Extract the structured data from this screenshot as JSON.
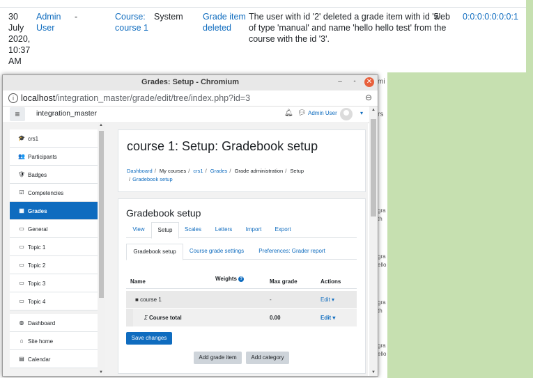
{
  "background_log": {
    "date": [
      "30",
      "July",
      "2020,",
      "10:37",
      "AM"
    ],
    "user": [
      "Admin",
      "User"
    ],
    "affected": "-",
    "context": [
      "Course:",
      "course 1"
    ],
    "component": "System",
    "event": [
      "Grade item",
      "deleted"
    ],
    "description": [
      "The user with id '2' deleted a grade item with id '5'",
      "of type 'manual' and name 'hello hello test' from the",
      "course with the id '3'."
    ],
    "origin": "web",
    "ip": "0:0:0:0:0:0:0:1",
    "snippets": [
      "mi",
      "rs",
      "gra",
      "th",
      "gra",
      "ello",
      "gra",
      "th",
      "gra",
      "ello"
    ]
  },
  "window": {
    "title": "Grades: Setup - Chromium",
    "minimize": "–",
    "maximize": "◦",
    "close": "✕"
  },
  "address_bar": {
    "host": "localhost",
    "path": "/integration_master/grade/edit/tree/index.php?id=3"
  },
  "navbar": {
    "site_name": "integration_master",
    "user_name": "Admin User"
  },
  "drawer": {
    "group1": [
      {
        "label": "crs1",
        "icon": "🎓"
      },
      {
        "label": "Participants",
        "icon": "👥"
      },
      {
        "label": "Badges",
        "icon": "🛡"
      },
      {
        "label": "Competencies",
        "icon": "☑"
      },
      {
        "label": "Grades",
        "icon": "▦",
        "active": true
      },
      {
        "label": "General",
        "icon": "▭"
      },
      {
        "label": "Topic 1",
        "icon": "▭"
      },
      {
        "label": "Topic 2",
        "icon": "▭"
      },
      {
        "label": "Topic 3",
        "icon": "▭"
      },
      {
        "label": "Topic 4",
        "icon": "▭"
      }
    ],
    "group2": [
      {
        "label": "Dashboard",
        "icon": "◍"
      },
      {
        "label": "Site home",
        "icon": "⌂"
      },
      {
        "label": "Calendar",
        "icon": "▤"
      }
    ]
  },
  "header": {
    "title": "course 1: Setup: Gradebook setup",
    "breadcrumb": [
      "Dashboard",
      "My courses",
      "crs1",
      "Grades",
      "Grade administration",
      "Setup",
      "Gradebook setup"
    ]
  },
  "main": {
    "title": "Gradebook setup",
    "tabs": [
      "View",
      "Setup",
      "Scales",
      "Letters",
      "Import",
      "Export"
    ],
    "subtabs": [
      "Gradebook setup",
      "Course grade settings",
      "Preferences: Grader report"
    ],
    "table": {
      "headers": {
        "name": "Name",
        "weights": "Weights",
        "max_grade": "Max grade",
        "actions": "Actions"
      },
      "rows": [
        {
          "name": "course 1",
          "max_grade": "-",
          "action": "Edit"
        },
        {
          "name": "Course total",
          "max_grade": "0.00",
          "action": "Edit"
        }
      ]
    },
    "save_label": "Save changes",
    "add_item_label": "Add grade item",
    "add_category_label": "Add category"
  },
  "colors": {
    "primary": "#0f6cbf",
    "desktop": "#c6e0b0"
  }
}
